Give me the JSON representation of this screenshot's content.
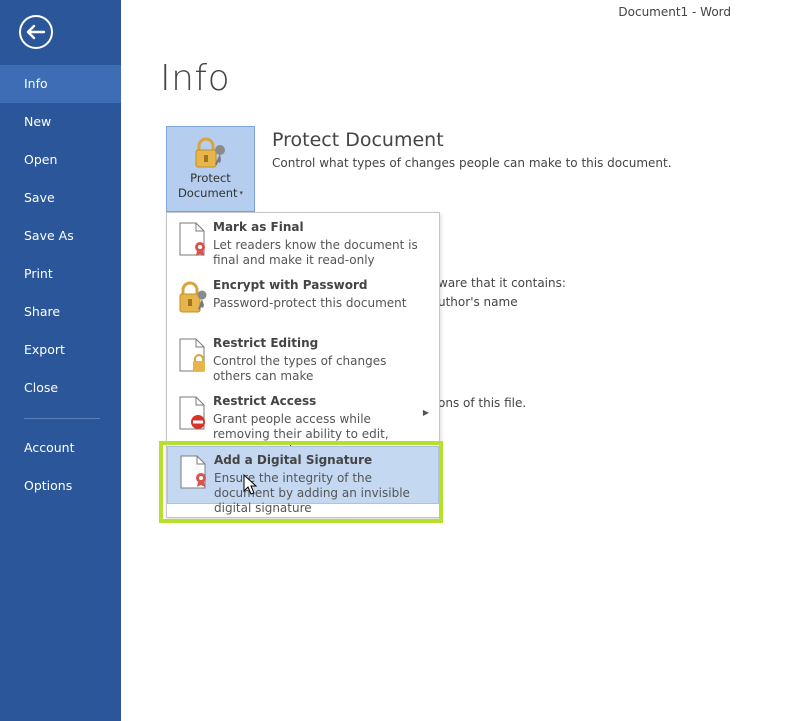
{
  "window": {
    "title": "Document1 - Word"
  },
  "sidebar": {
    "back_icon": "back-arrow-icon",
    "items": [
      {
        "label": "Info",
        "active": true
      },
      {
        "label": "New"
      },
      {
        "label": "Open"
      },
      {
        "label": "Save"
      },
      {
        "label": "Save As"
      },
      {
        "label": "Print"
      },
      {
        "label": "Share"
      },
      {
        "label": "Export"
      },
      {
        "label": "Close"
      },
      {
        "label": "Account"
      },
      {
        "label": "Options"
      }
    ]
  },
  "main": {
    "title": "Info",
    "protect": {
      "button_label_line1": "Protect",
      "button_label_line2": "Document",
      "caret": "▾",
      "heading": "Protect Document",
      "description": "Control what types of changes people can make to this document."
    },
    "background_fragments": [
      "ware that it contains:",
      "uthor's name",
      "ons of this file."
    ]
  },
  "protect_menu": {
    "items": [
      {
        "title": "Mark as Final",
        "desc": "Let readers know the document is final and make it read-only",
        "icon": "mark-final-icon"
      },
      {
        "title": "Encrypt with Password",
        "desc": "Password-protect this document",
        "icon": "encrypt-lock-icon"
      },
      {
        "title": "Restrict Editing",
        "desc": "Control the types of changes others can make",
        "icon": "restrict-editing-icon"
      },
      {
        "title": "Restrict Access",
        "desc": "Grant people access while removing their ability to edit, copy, or print.",
        "icon": "restrict-access-icon",
        "submenu_arrow": "▶"
      },
      {
        "title": "Add a Digital Signature",
        "desc": "Ensure the integrity of the document by adding an invisible digital signature",
        "icon": "digital-signature-icon",
        "hovered": true
      }
    ]
  },
  "colors": {
    "sidebar": "#2b579a",
    "sidebar_active": "#3e6db5",
    "menu_hover": "#c5d8f2",
    "highlight": "#b6e02c"
  }
}
